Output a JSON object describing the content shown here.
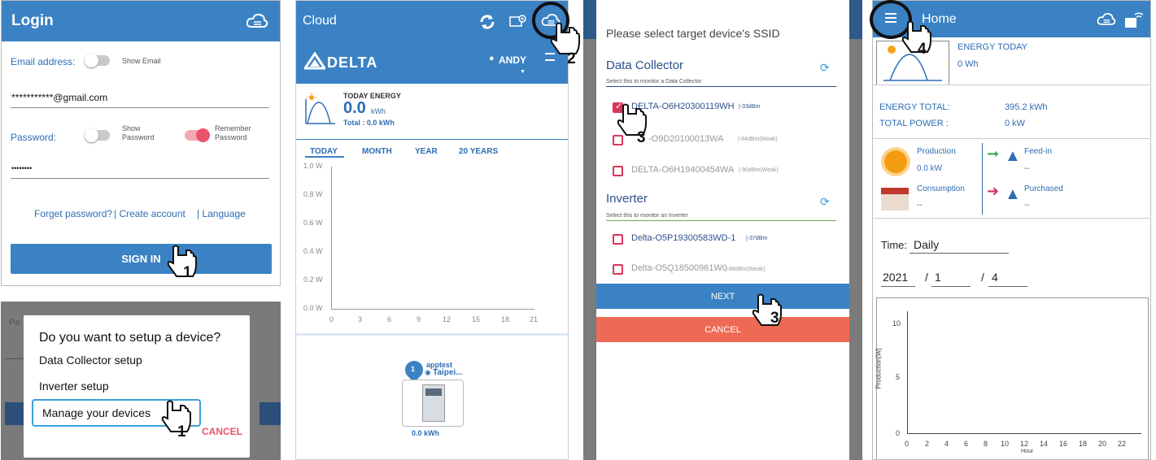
{
  "login": {
    "title": "Login",
    "email_label": "Email address:",
    "show_email": "Show Email",
    "email_value": "***********@gmail.com",
    "password_label": "Password:",
    "show_password_1": "Show",
    "show_password_2": "Password",
    "remember_1": "Remember",
    "remember_2": "Password",
    "password_value": "••••••••",
    "forget": "Forget password?",
    "create": "| Create account",
    "language": "| Language",
    "signin": "SIGN IN",
    "step": "1"
  },
  "dialog": {
    "pa": "Pa",
    "title": "Do you want to setup a device?",
    "opt1": "Data Collector setup",
    "opt2": "Inverter setup",
    "opt3": "Manage your devices",
    "cancel": "CANCEL",
    "step": "1"
  },
  "cloud": {
    "title": "Cloud",
    "logo": "DELTA",
    "user": "ANDY",
    "today_energy_label": "TODAY ENERGY",
    "today_value": "0.0",
    "today_unit": "kWh",
    "total": "Total : 0.0 kWh",
    "tabs": [
      "TODAY",
      "MONTH",
      "YEAR",
      "20 YEARS"
    ],
    "y_ticks": [
      "1.0 W",
      "0.8 W",
      "0.6 W",
      "0.4 W",
      "0.2 W",
      "0.0 W"
    ],
    "x_ticks": [
      "0",
      "3",
      "6",
      "9",
      "12",
      "15",
      "18",
      "21"
    ],
    "site_name": "apptest",
    "site_loc": "Taipei...",
    "site_count": "1",
    "site_energy": "0.0 kWh",
    "step": "2"
  },
  "ssid": {
    "title": "Please select target device's SSID",
    "dc_heading": "Data Collector",
    "dc_hint": "Select this to monitor a Data Collector",
    "dc_devices": [
      {
        "name": "DELTA-O6H20300119WH",
        "signal": "|-33dBm"
      },
      {
        "name": "-O9D20100013WA",
        "signal": "|-84dBm(Weak)"
      },
      {
        "name": "DELTA-O6H19400454WA",
        "signal": "|-90dBm(Weak)"
      }
    ],
    "inv_heading": "Inverter",
    "inv_hint": "Select this to monitor an Inverter",
    "inv_devices": [
      {
        "name": "Delta-O5P19300583WD-1",
        "signal": "|-37dBm"
      },
      {
        "name": "Delta-O5Q18500961W0",
        "signal": "|-86dBm(Weak)"
      }
    ],
    "next": "NEXT",
    "cancel": "CANCEL",
    "step": "3"
  },
  "home": {
    "title": "Home",
    "energy_today_label": "ENERGY TODAY",
    "energy_today_value": "0 Wh",
    "energy_total_label": "ENERGY TOTAL:",
    "energy_total_value": "395.2 kWh",
    "total_power_label": "TOTAL POWER :",
    "total_power_value": "0 kW",
    "production_label": "Production",
    "production_value": "0.0 kW",
    "feedin_label": "Feed-in",
    "feedin_value": "--",
    "consumption_label": "Consumption",
    "consumption_value": "--",
    "purchased_label": "Purchased",
    "purchased_value": "--",
    "time_label": "Time:",
    "time_value": "Daily",
    "year": "2021",
    "month": "1",
    "day": "4",
    "sep": "/",
    "y_ticks": [
      "10",
      "5",
      "0"
    ],
    "x_ticks": [
      "0",
      "2",
      "4",
      "6",
      "8",
      "10",
      "12",
      "14",
      "16",
      "18",
      "20",
      "22"
    ],
    "ylabel": "Production[W]",
    "xlabel": "Hour",
    "step": "4"
  },
  "colors": {
    "header": "#3b82c4",
    "button": "#3b82c4",
    "cancel": "#ef6a55",
    "pink": "#e8526b"
  }
}
